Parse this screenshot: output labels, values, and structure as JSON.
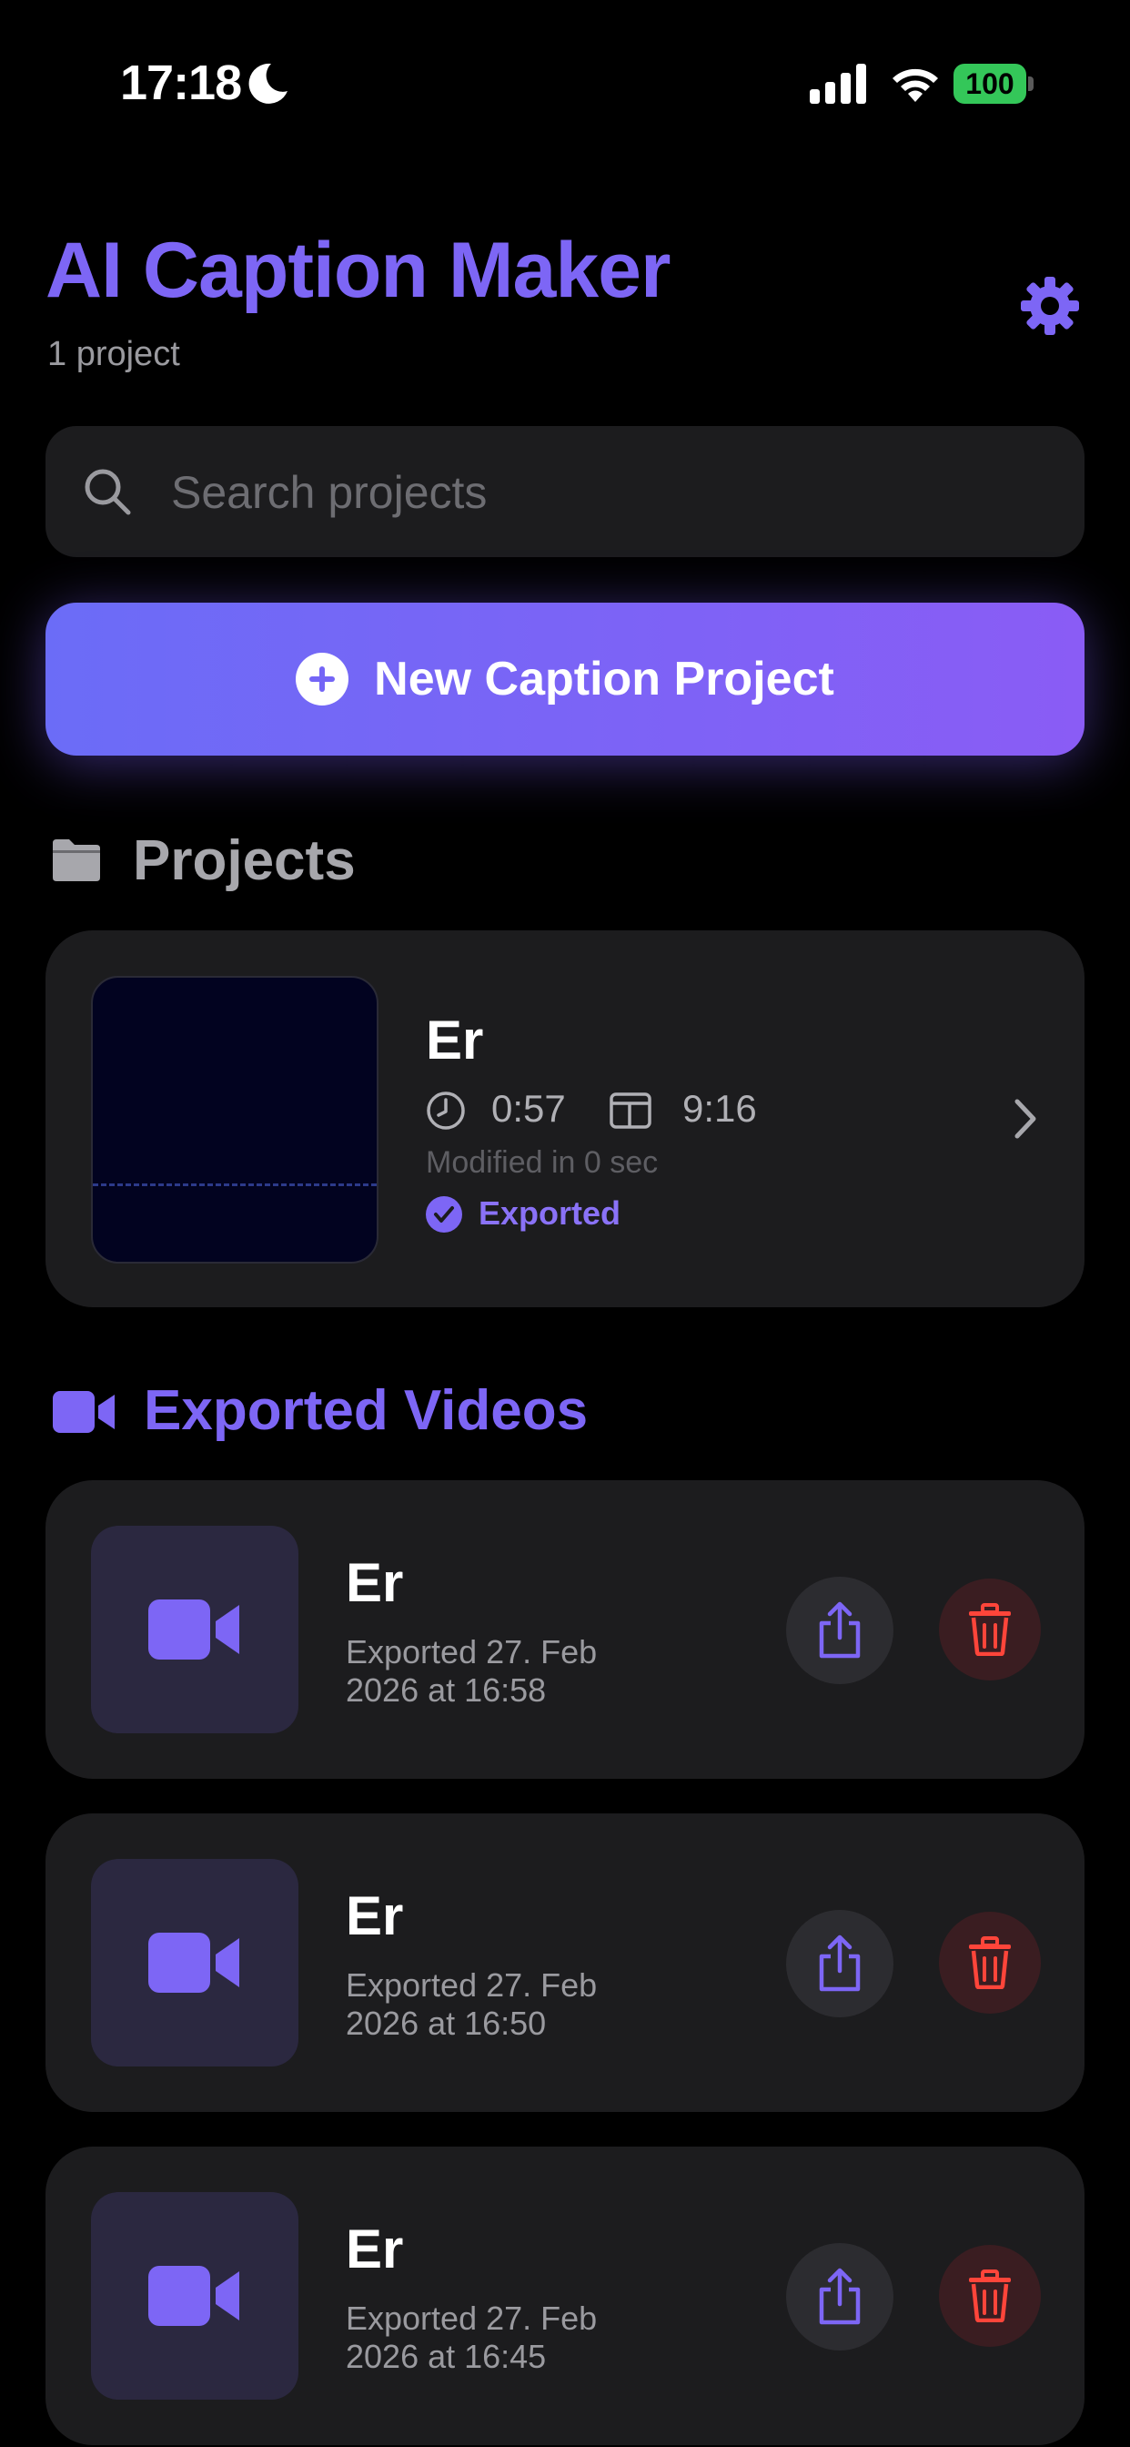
{
  "status_bar": {
    "time": "17:18",
    "battery": "100"
  },
  "header": {
    "title": "AI Caption Maker",
    "project_count": "1 project"
  },
  "search": {
    "placeholder": "Search projects",
    "value": ""
  },
  "new_project_button": {
    "label": "New Caption Project"
  },
  "projects_section": {
    "heading": "Projects",
    "items": [
      {
        "name": "Er",
        "duration": "0:57",
        "aspect_ratio": "9:16",
        "modified": "Modified in 0 sec",
        "status": "Exported"
      }
    ]
  },
  "exported_section": {
    "heading": "Exported Videos",
    "items": [
      {
        "name": "Er",
        "date_line1": "Exported 27. Feb",
        "date_line2": "2026 at 16:58"
      },
      {
        "name": "Er",
        "date_line1": "Exported 27. Feb",
        "date_line2": "2026 at 16:50"
      },
      {
        "name": "Er",
        "date_line1": "Exported 27. Feb",
        "date_line2": "2026 at 16:45"
      }
    ]
  },
  "colors": {
    "accent": "#7d66f5",
    "background": "#000000",
    "card": "#1c1c1e",
    "delete": "#ff453a",
    "battery": "#34c759"
  },
  "icons": [
    "moon-icon",
    "signal-icon",
    "wifi-icon",
    "battery-icon",
    "gear-icon",
    "search-icon",
    "plus-circle-icon",
    "folder-icon",
    "clock-icon",
    "aspect-ratio-icon",
    "checkmark-circle-icon",
    "chevron-right-icon",
    "video-camera-icon",
    "share-icon",
    "trash-icon"
  ]
}
